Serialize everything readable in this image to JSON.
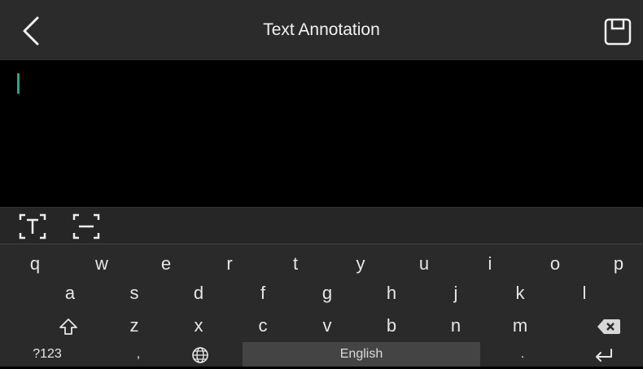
{
  "header": {
    "title": "Text Annotation"
  },
  "icons": {
    "back": "chevron-left-icon",
    "save": "save-icon",
    "text_box": "text-box-icon",
    "strike": "strikethrough-box-icon",
    "shift": "shift-icon",
    "backspace": "backspace-icon",
    "globe": "globe-icon",
    "enter": "enter-icon"
  },
  "colors": {
    "cursor": "#2fa58c",
    "header_bg": "#2b2b2b",
    "keyboard_bg": "#2a2a2a"
  },
  "keyboard": {
    "row1": [
      "q",
      "w",
      "e",
      "r",
      "t",
      "y",
      "u",
      "i",
      "o",
      "p"
    ],
    "row2": [
      "a",
      "s",
      "d",
      "f",
      "g",
      "h",
      "j",
      "k",
      "l"
    ],
    "row3": [
      "z",
      "x",
      "c",
      "v",
      "b",
      "n",
      "m"
    ],
    "row4": {
      "symbols": "?123",
      "comma": ",",
      "space": "English",
      "period": "."
    }
  }
}
